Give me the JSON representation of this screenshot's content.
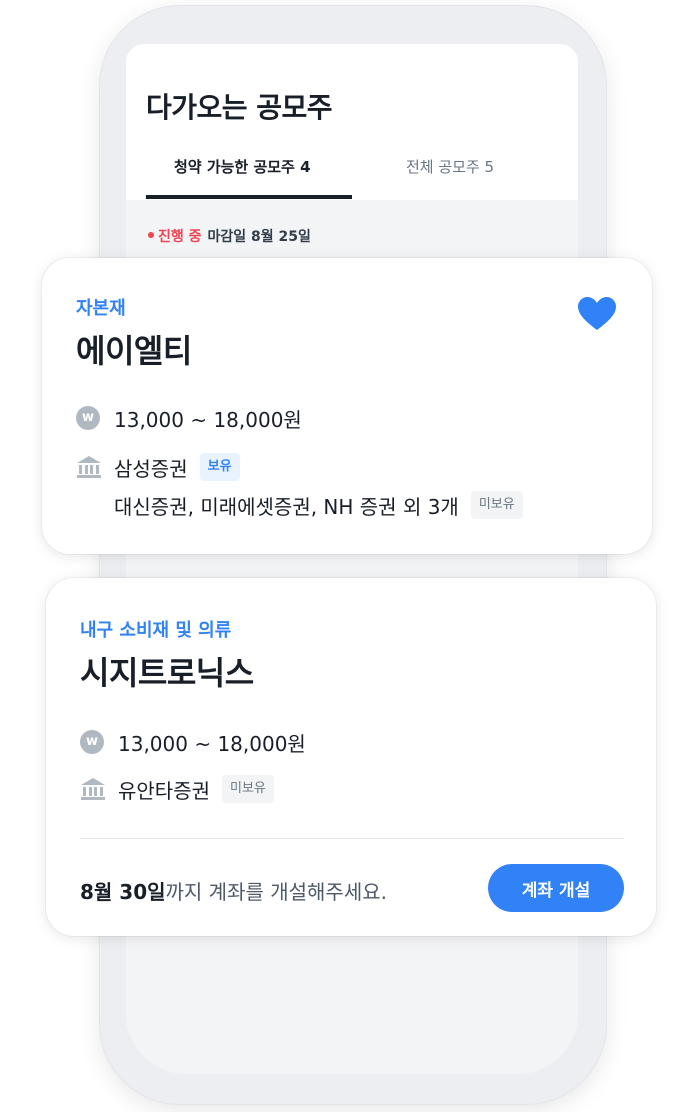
{
  "screen": {
    "title": "다가오는 공모주",
    "tabs": [
      {
        "label": "청약 가능한 공모주 4",
        "active": true
      },
      {
        "label": "전체 공모주 5",
        "active": false
      }
    ],
    "status": {
      "live": "진행 중",
      "deadline": "마감일 8월 25일"
    }
  },
  "cards": [
    {
      "category": "자본재",
      "company": "에이엘티",
      "favorited": true,
      "price": "13,000 ~ 18,000원",
      "brokers": [
        {
          "name": "삼성증권",
          "badge": "보유"
        },
        {
          "name": "대신증권, 미래에셋증권, NH 증권 외 3개",
          "badge": "미보유"
        }
      ]
    },
    {
      "category": "내구 소비재 및 의류",
      "company": "시지트로닉스",
      "price": "13,000 ~ 18,000원",
      "brokers": [
        {
          "name": "유안타증권",
          "badge": "미보유"
        }
      ],
      "footer": {
        "date": "8월 30일",
        "message": "까지 계좌를 개설해주세요.",
        "button": "계좌 개설"
      }
    }
  ],
  "icons": {
    "won": "won-coin-icon",
    "bank": "bank-icon",
    "heart": "heart-icon"
  },
  "colors": {
    "accent": "#3182f6",
    "live": "#f04452",
    "text": "#191f28",
    "sub": "#6b7684",
    "icon": "#b0b8c1"
  }
}
